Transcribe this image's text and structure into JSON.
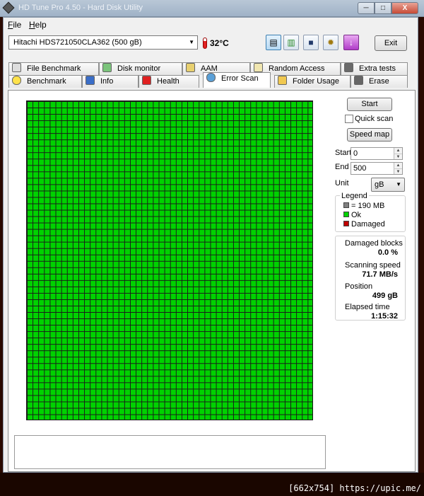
{
  "window": {
    "title": "HD Tune Pro 4.50 - Hard Disk Utility",
    "controls": {
      "minimize": "─",
      "maximize": "□",
      "close": "X"
    }
  },
  "menu": [
    {
      "label": "File"
    },
    {
      "label": "Help"
    }
  ],
  "toolbar": {
    "drive": "Hitachi HDS721050CLA362 (500 gB)",
    "temperature": "32°C",
    "buttons": [
      {
        "icon": "copy-text-icon"
      },
      {
        "icon": "copy-screenshot-icon"
      },
      {
        "icon": "save-icon"
      },
      {
        "icon": "options-icon"
      },
      {
        "icon": "download-icon"
      }
    ],
    "exit_label": "Exit"
  },
  "tabs_row1": [
    {
      "label": "File Benchmark",
      "icon": "file-benchmark-icon"
    },
    {
      "label": "Disk monitor",
      "icon": "disk-monitor-icon"
    },
    {
      "label": "AAM",
      "icon": "speaker-icon"
    },
    {
      "label": "Random Access",
      "icon": "random-access-icon"
    },
    {
      "label": "Extra tests",
      "icon": "extra-tests-icon"
    }
  ],
  "tabs_row2": [
    {
      "label": "Benchmark",
      "icon": "bulb-icon"
    },
    {
      "label": "Info",
      "icon": "info-icon"
    },
    {
      "label": "Health",
      "icon": "health-cross-icon"
    },
    {
      "label": "Error Scan",
      "icon": "magnifier-icon",
      "selected": true
    },
    {
      "label": "Folder Usage",
      "icon": "folder-icon"
    },
    {
      "label": "Erase",
      "icon": "trash-icon"
    }
  ],
  "scan": {
    "start_button": "Start",
    "quick_scan_label": "Quick scan",
    "quick_scan_checked": false,
    "speed_map_button": "Speed map",
    "start_label": "Start",
    "start_value": "0",
    "end_label": "End",
    "end_value": "500",
    "unit_label": "Unit",
    "unit_value": "gB",
    "block_grid": {
      "columns": 50,
      "rows": 50,
      "state": "ok"
    }
  },
  "legend": {
    "title": "Legend",
    "items": [
      {
        "label": "= 190 MB",
        "color": "#808080"
      },
      {
        "label": "Ok",
        "color": "#00d200"
      },
      {
        "label": "Damaged",
        "color": "#c00000"
      }
    ]
  },
  "stats": {
    "damaged_label": "Damaged blocks",
    "damaged_value": "0.0 %",
    "speed_label": "Scanning speed",
    "speed_value": "71.7 MB/s",
    "position_label": "Position",
    "position_value": "499 gB",
    "elapsed_label": "Elapsed time",
    "elapsed_value": "1:15:32"
  },
  "watermark": "[662x754] https://upic.me/"
}
